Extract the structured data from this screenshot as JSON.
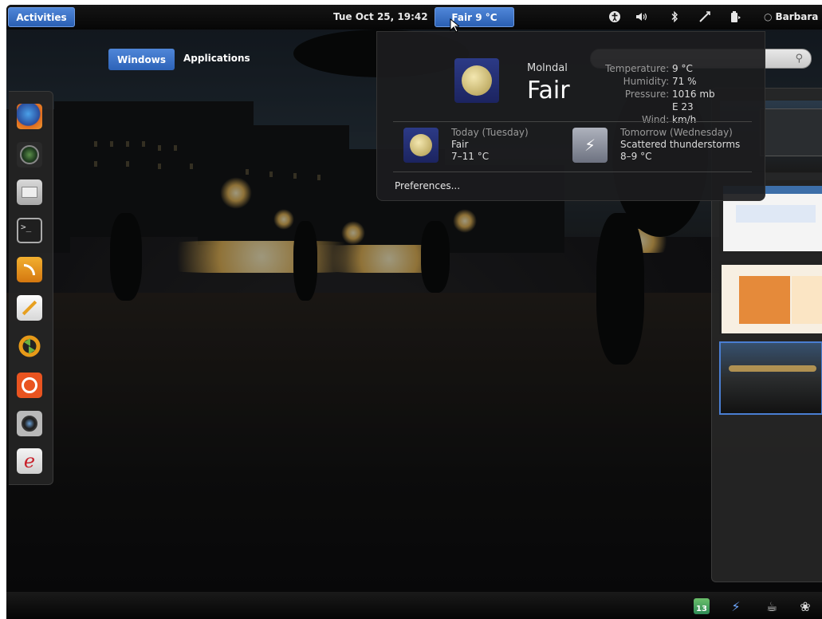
{
  "top_panel": {
    "activities_label": "Activities",
    "clock": "Tue Oct 25, 19:42",
    "weather_button": "Fair 9 °C",
    "user_name": "Barbara",
    "indicator_icons": [
      "accessibility-icon",
      "volume-icon",
      "bluetooth-icon",
      "network-icon",
      "power-icon"
    ]
  },
  "overview": {
    "tabs": [
      {
        "label": "Windows",
        "active": true
      },
      {
        "label": "Applications",
        "active": false
      }
    ]
  },
  "weather": {
    "location": "Molndal",
    "condition": "Fair",
    "details": [
      {
        "label": "Temperature:",
        "value": "9 °C"
      },
      {
        "label": "Humidity:",
        "value": "71 %"
      },
      {
        "label": "Pressure:",
        "value": "1016 mb"
      },
      {
        "label": "Wind:",
        "value": "E 23 km/h"
      }
    ],
    "today": {
      "day": "Today (Tuesday)",
      "condition": "Fair",
      "range": "7–11 °C"
    },
    "tomorrow": {
      "day": "Tomorrow (Wednesday)",
      "condition": "Scattered thunderstorms",
      "range": "8–9 °C"
    },
    "preferences_label": "Preferences..."
  },
  "dash": {
    "apps": [
      "firefox-icon",
      "shotwell-icon",
      "file-manager-icon",
      "terminal-icon",
      "rss-reader-icon",
      "text-editor-icon",
      "update-manager-icon",
      "ubuntu-one-icon",
      "camera-icon",
      "evolution-mail-icon"
    ]
  },
  "workspaces": {
    "count": 4,
    "active_index": 3
  },
  "tray": {
    "badge": "13",
    "icons": [
      "calendar-icon",
      "lightning-icon",
      "coffee-icon",
      "palette-icon"
    ]
  },
  "colors": {
    "accent": "#3b72c8",
    "panel": "#0b0b0b",
    "popup": "#1c1c1e"
  }
}
